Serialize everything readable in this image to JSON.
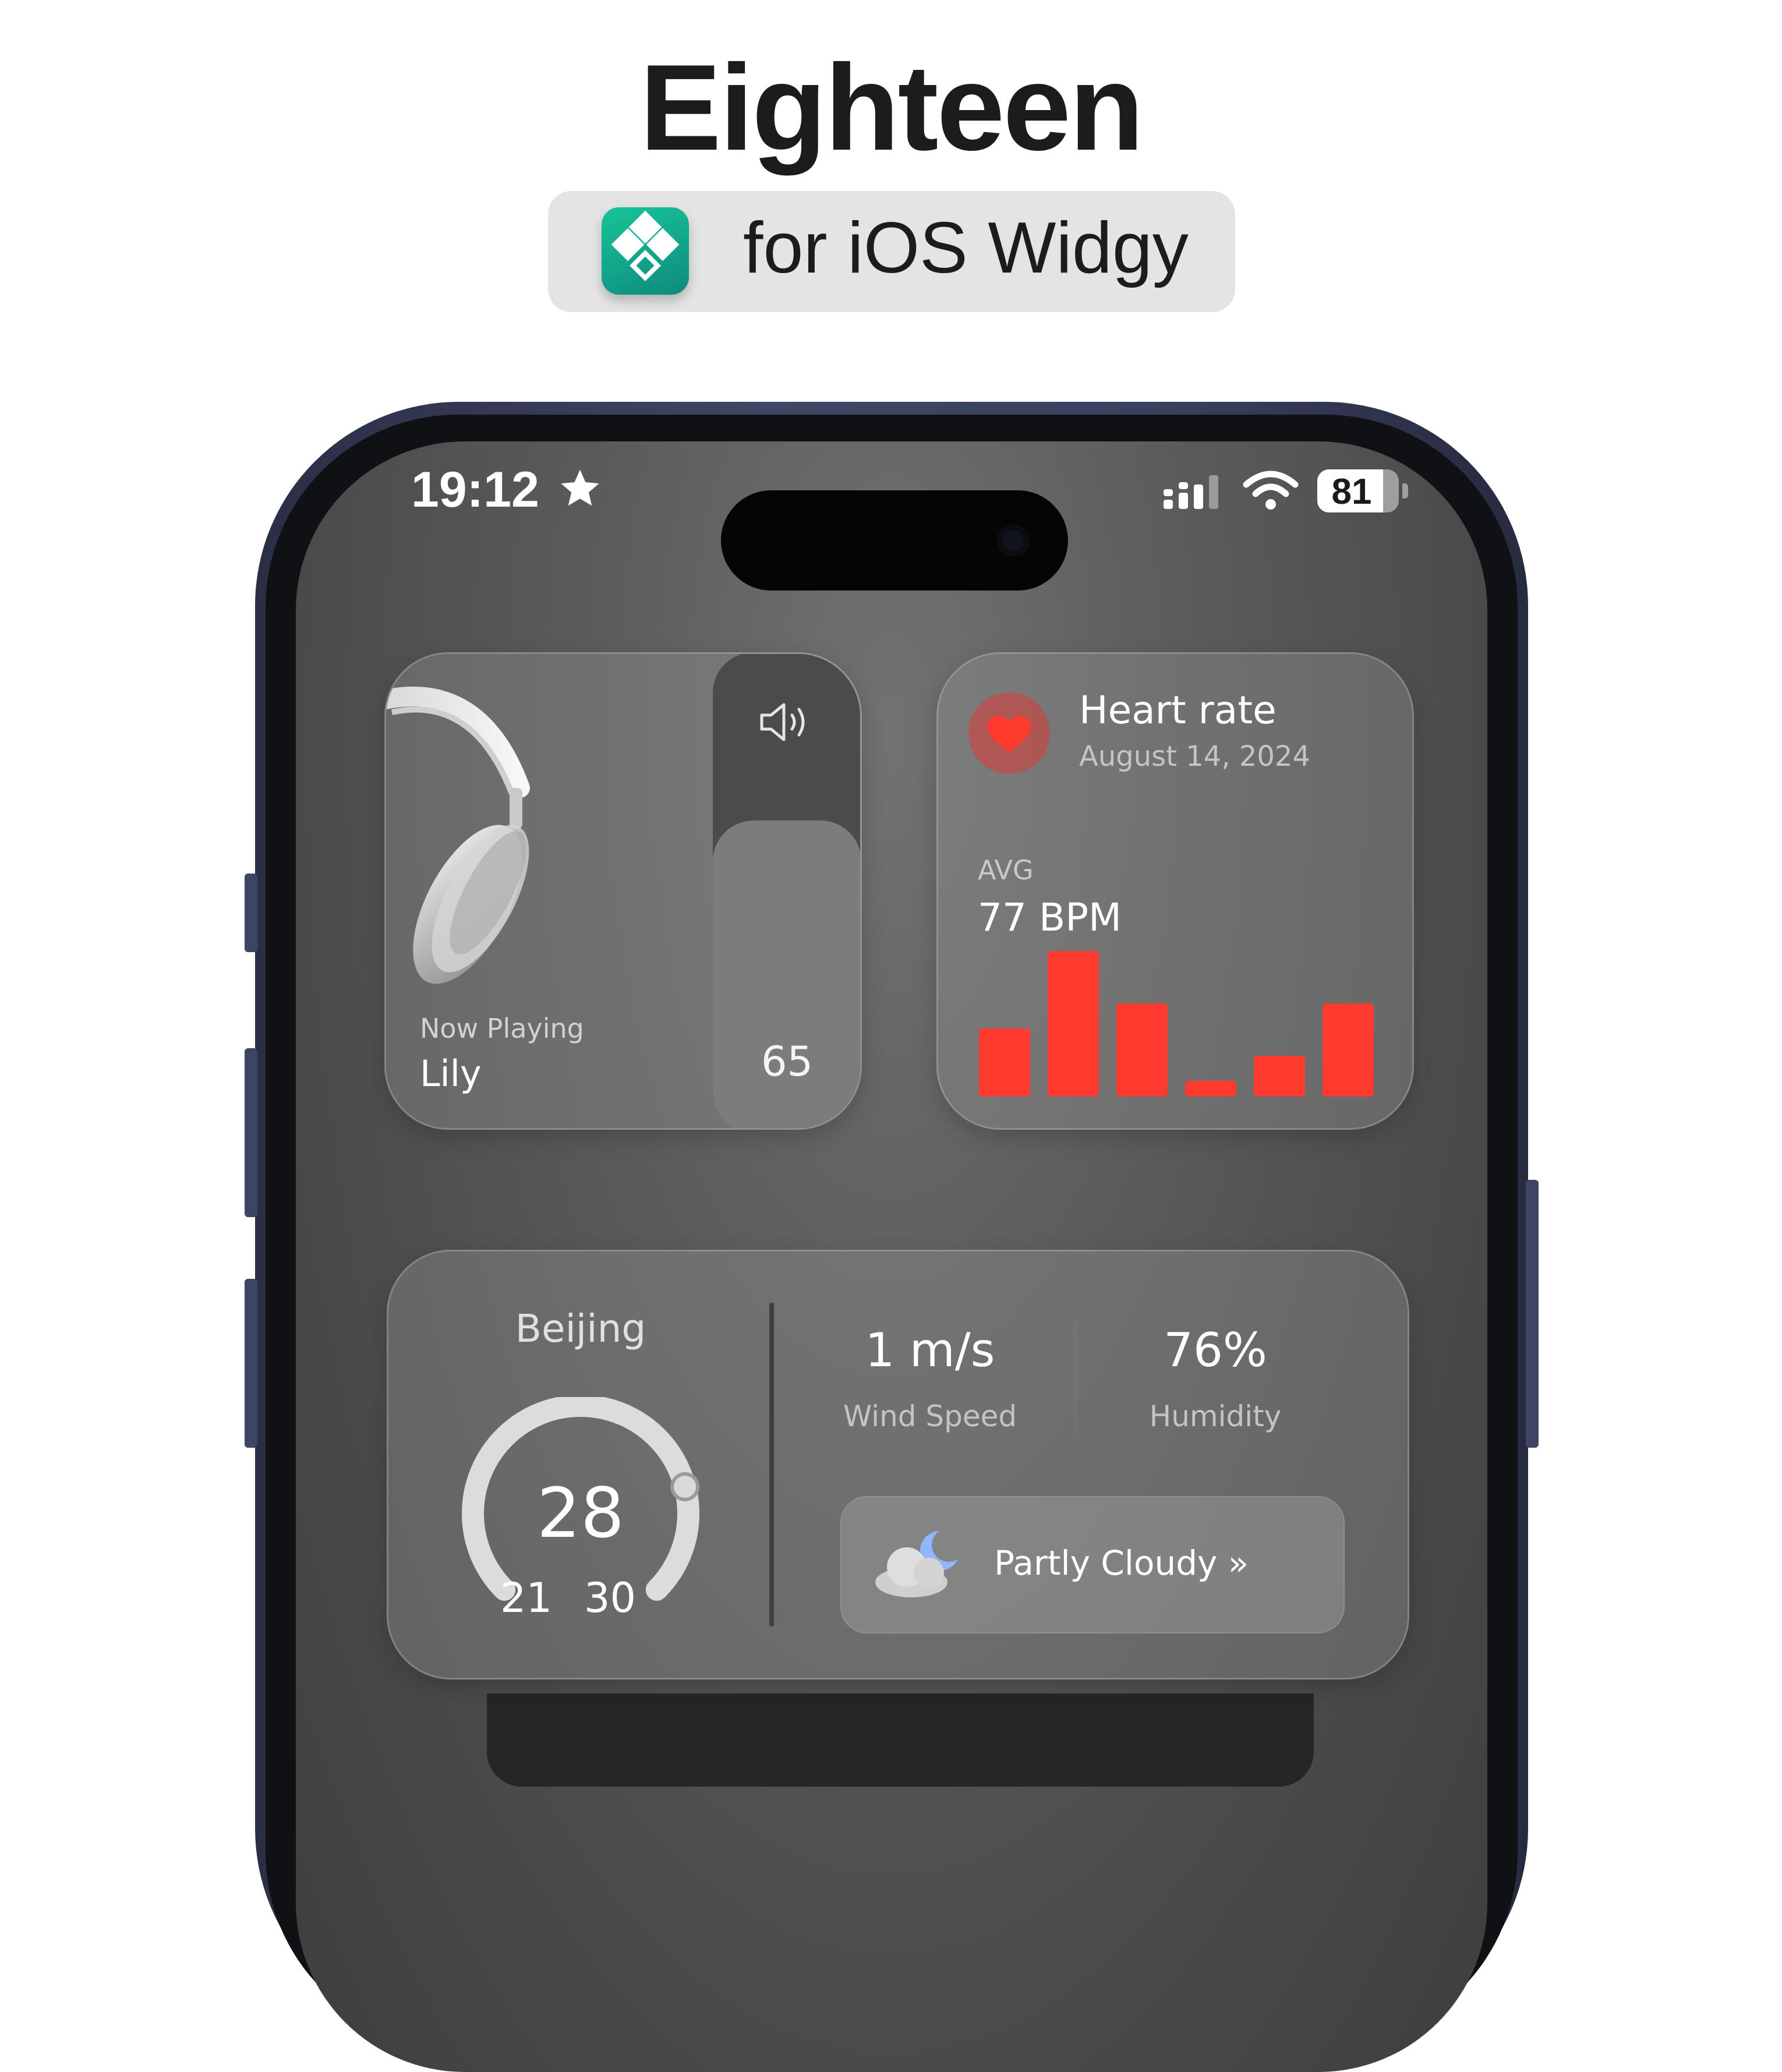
{
  "header": {
    "title": "Eighteen",
    "subtitle": "for iOS Widgy",
    "app_icon": "widgy-app-icon",
    "accent_color": "#12a58a"
  },
  "status_bar": {
    "time": "19:12",
    "time_icon": "star-icon",
    "signal_icon": "cellular-signal-icon",
    "wifi_icon": "wifi-icon",
    "battery_level": "81",
    "battery_fraction": 0.81
  },
  "music_widget": {
    "label": "Now Playing",
    "track": "Lily",
    "volume": "65",
    "volume_fraction": 0.65,
    "speaker_icon": "speaker-icon",
    "image": "headphones-image"
  },
  "heart_widget": {
    "title": "Heart rate",
    "date": "August 14, 2024",
    "avg_label": "AVG",
    "avg_value": "77 BPM",
    "icon": "heart-icon",
    "bar_color": "#ff3b30",
    "chart_data": {
      "type": "bar",
      "values": [
        60,
        128,
        82,
        14,
        36,
        82
      ]
    }
  },
  "weather_widget": {
    "city": "Beijing",
    "temp": "28",
    "low": "21",
    "high": "30",
    "temp_fraction": 0.78,
    "wind_value": "1 m/s",
    "wind_label": "Wind Speed",
    "humidity_value": "76%",
    "humidity_label": "Humidity",
    "condition": "Partly Cloudy »",
    "condition_icon": "partly-cloudy-night-icon"
  }
}
